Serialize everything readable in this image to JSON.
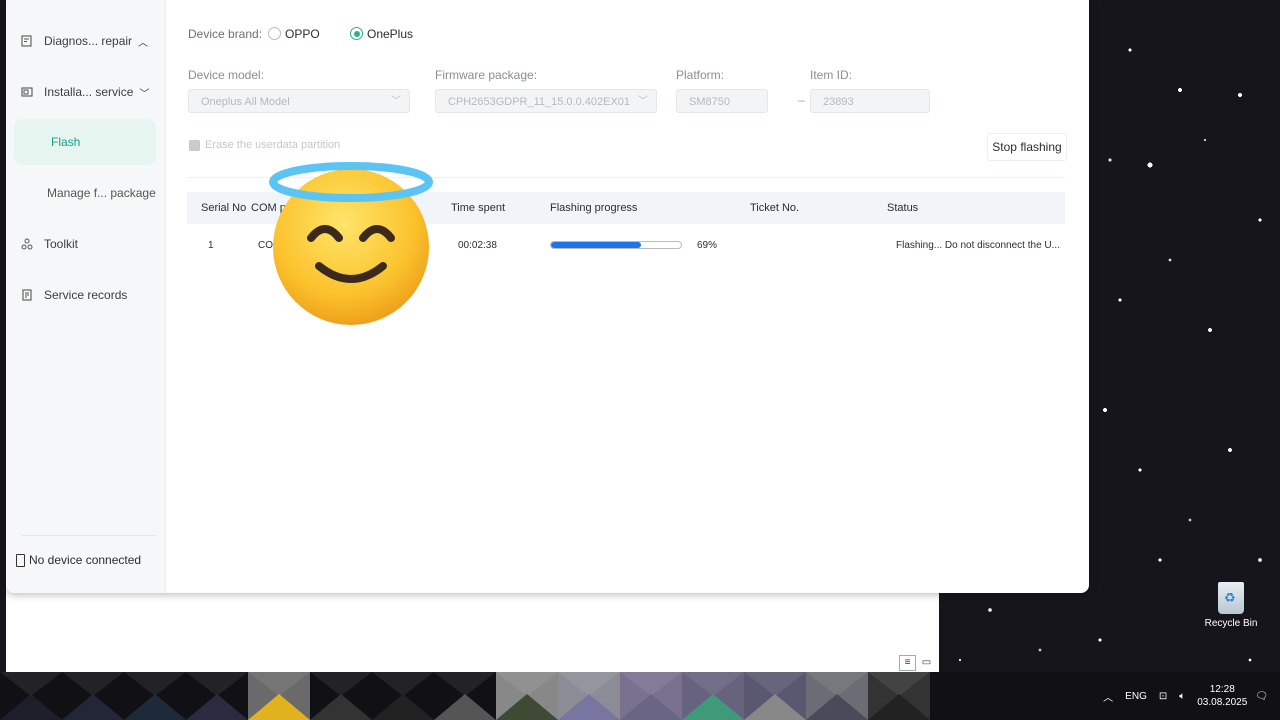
{
  "sidebar": {
    "items": [
      {
        "label": "Diagnos... repair",
        "icon": "diagnosis-icon",
        "chevron": "up"
      },
      {
        "label": "Installa... service",
        "icon": "install-icon",
        "chevron": "down"
      },
      {
        "label": "Flash",
        "active": true
      },
      {
        "label": "Manage f... package"
      },
      {
        "label": "Toolkit",
        "icon": "toolkit-icon"
      },
      {
        "label": "Service records",
        "icon": "records-icon"
      }
    ],
    "footer": "No device connected"
  },
  "form": {
    "brand_label": "Device brand:",
    "brand_options": [
      "OPPO",
      "OnePlus"
    ],
    "brand_selected": "OnePlus",
    "model_label": "Device model:",
    "model_value": "Oneplus All Model",
    "firmware_label": "Firmware package:",
    "firmware_value": "CPH2653GDPR_11_15.0.0.402EX01",
    "platform_label": "Platform:",
    "platform_value": "SM8750",
    "item_label": "Item ID:",
    "item_value": "23893",
    "dash": "–",
    "erase_label": "Erase the userdata partition",
    "stop_button": "Stop flashing"
  },
  "table": {
    "headers": [
      "Serial No",
      "COM p",
      "Time spent",
      "Flashing progress",
      "Ticket No.",
      "Status"
    ],
    "rows": [
      {
        "serial": "1",
        "com": "COM",
        "time": "00:02:38",
        "progress": 0.69,
        "progress_label": "69%",
        "ticket": "",
        "status": "Flashing... Do not disconnect the U..."
      }
    ]
  },
  "colors": {
    "accent": "#2bb08a",
    "progress": "#1f74e8"
  },
  "taskbar": {
    "lang": "ENG",
    "time": "12:28",
    "date": "03.08.2025"
  },
  "desktop": {
    "recycle_bin": "Recycle Bin"
  }
}
